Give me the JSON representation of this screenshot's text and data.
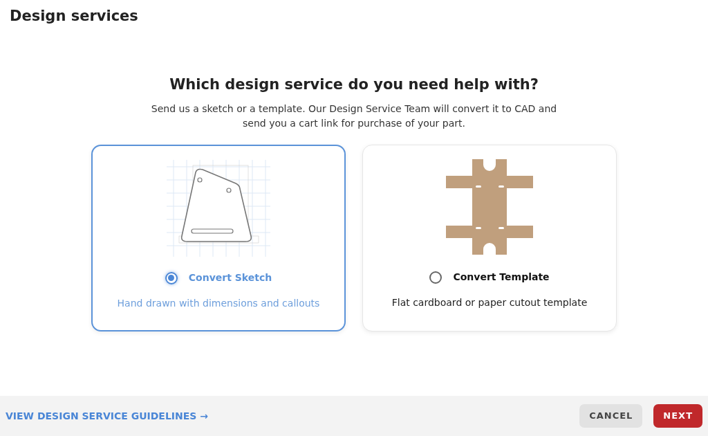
{
  "page_title": "Design services",
  "question": "Which design service do you need help with?",
  "intro_lines": [
    "Send us a sketch or a template. Our Design Service Team will convert it to CAD and",
    "send you a cart link for purchase of your part."
  ],
  "options": [
    {
      "kind": "sketch",
      "label": "Convert Sketch",
      "description": "Hand drawn with dimensions and callouts",
      "selected": true
    },
    {
      "kind": "template",
      "label": "Convert Template",
      "description": "Flat cardboard or paper cutout template",
      "selected": false
    }
  ],
  "footer": {
    "guidelines_link": "VIEW DESIGN SERVICE GUIDELINES →",
    "buttons": [
      {
        "kind": "secondary",
        "label": "CANCEL"
      },
      {
        "kind": "primary",
        "label": "NEXT"
      }
    ]
  }
}
